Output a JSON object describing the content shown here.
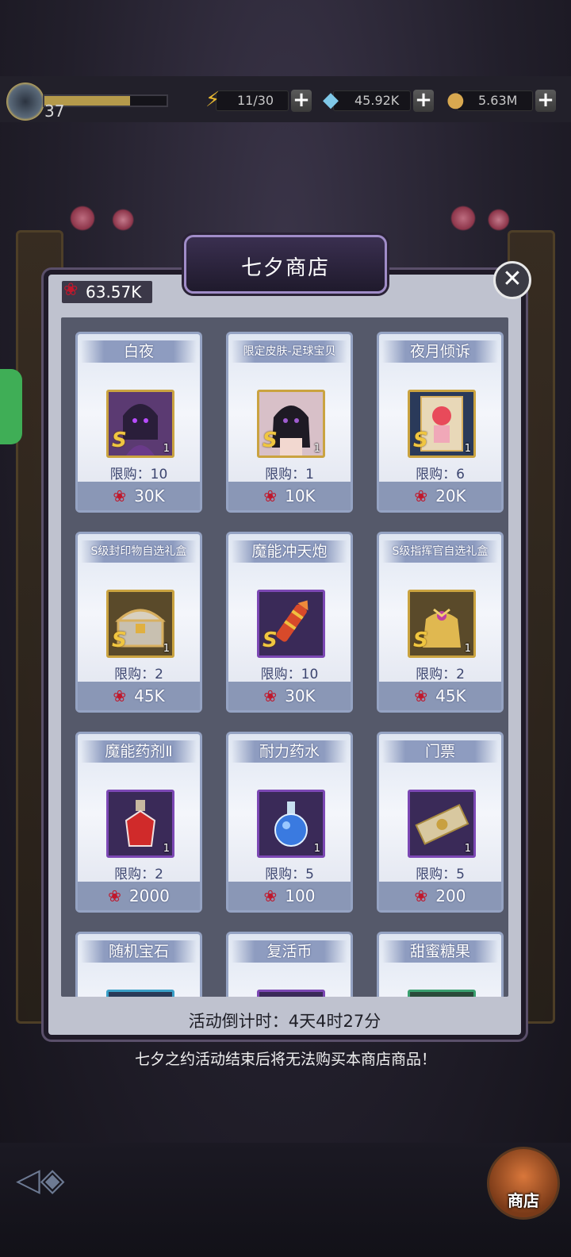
{
  "hud": {
    "level": "37",
    "xp_progress": 0.7,
    "energy": "11/30",
    "diamonds": "45.92K",
    "gold": "5.63M"
  },
  "shop": {
    "title": "七夕商店",
    "currency_amount": "63.57K",
    "countdown": "活动倒计时：4天4时27分",
    "notice": "七夕之约活动结束后将无法购买本商店商品！",
    "items": [
      {
        "name": "白夜",
        "limit": "限购：10",
        "price": "30K",
        "qty": "1",
        "rank": "S",
        "icon": "character-portrait-icon"
      },
      {
        "name": "限定皮肤-足球宝贝",
        "limit": "限购：1",
        "price": "10K",
        "qty": "1",
        "rank": "S",
        "icon": "skin-portrait-icon"
      },
      {
        "name": "夜月倾诉",
        "limit": "限购：6",
        "price": "20K",
        "qty": "1",
        "rank": "S",
        "icon": "card-art-icon"
      },
      {
        "name": "S级封印物自选礼盒",
        "limit": "限购：2",
        "price": "45K",
        "qty": "1",
        "rank": "S",
        "icon": "treasure-chest-icon"
      },
      {
        "name": "魔能冲天炮",
        "limit": "限购：10",
        "price": "30K",
        "qty": "",
        "rank": "S",
        "icon": "firework-rocket-icon"
      },
      {
        "name": "S级指挥官自选礼盒",
        "limit": "限购：2",
        "price": "45K",
        "qty": "1",
        "rank": "S",
        "icon": "gift-bag-icon"
      },
      {
        "name": "魔能药剂Ⅱ",
        "limit": "限购：2",
        "price": "2000",
        "qty": "1",
        "rank": "",
        "icon": "red-potion-icon"
      },
      {
        "name": "耐力药水",
        "limit": "限购：5",
        "price": "100",
        "qty": "1",
        "rank": "",
        "icon": "blue-potion-icon"
      },
      {
        "name": "门票",
        "limit": "限购：5",
        "price": "200",
        "qty": "1",
        "rank": "",
        "icon": "ticket-icon"
      },
      {
        "name": "随机宝石",
        "limit": "",
        "price": "",
        "qty": "",
        "rank": "",
        "icon": "gem-icon"
      },
      {
        "name": "复活币",
        "limit": "",
        "price": "",
        "qty": "",
        "rank": "",
        "icon": "revive-coin-icon"
      },
      {
        "name": "甜蜜糖果",
        "limit": "",
        "price": "",
        "qty": "",
        "rank": "",
        "icon": "candy-icon"
      }
    ]
  },
  "nav": {
    "shop_label": "商店"
  },
  "colors": {
    "rose": "#c0182c",
    "card_border": "#95a3c3",
    "gold_frame": "#caa340",
    "purple_frame": "#7c48b4"
  }
}
